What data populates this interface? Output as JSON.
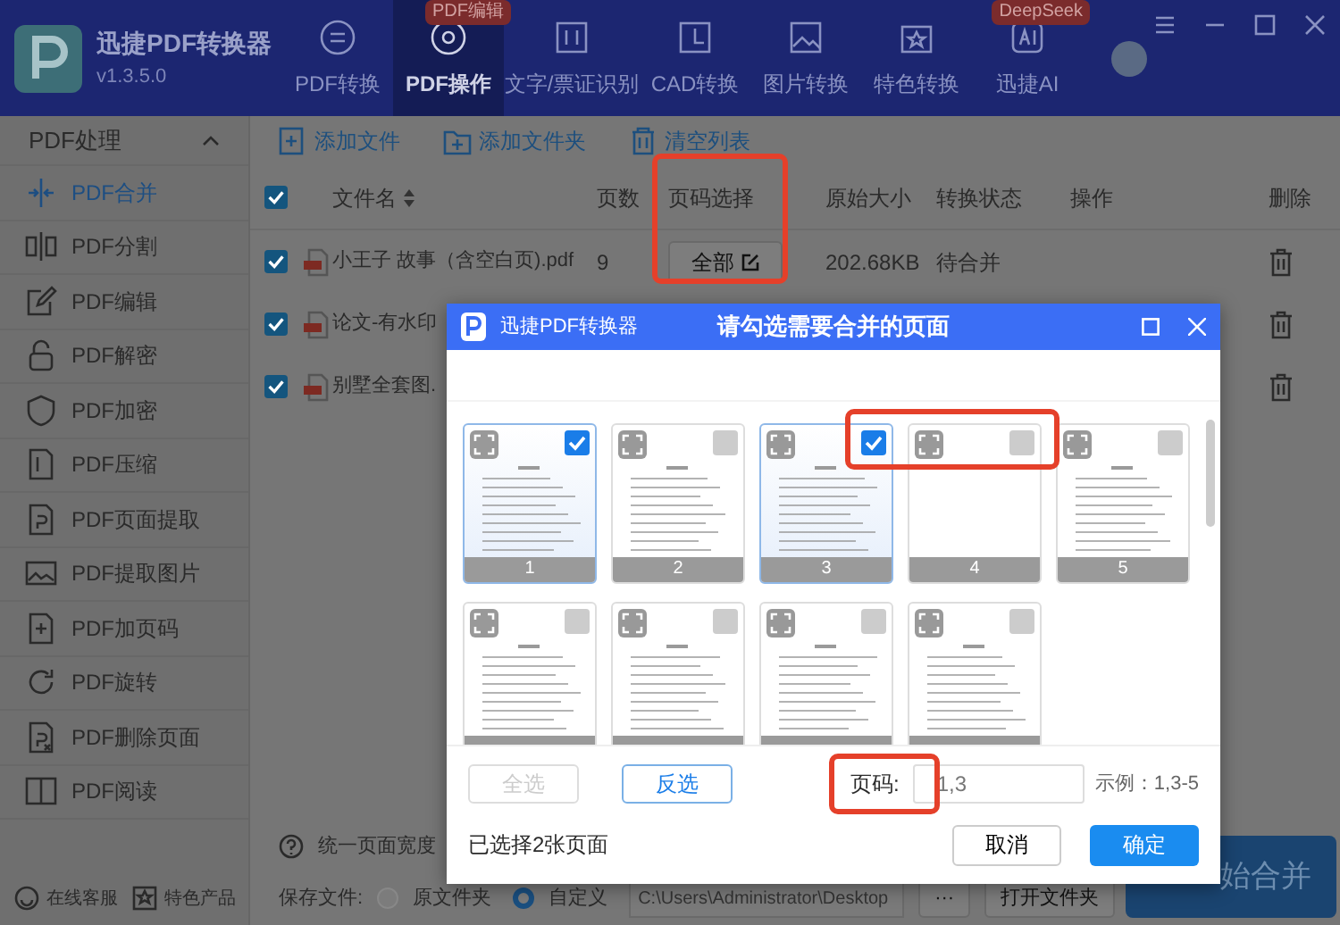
{
  "app": {
    "name": "迅捷PDF转换器",
    "version": "v1.3.5.0"
  },
  "nav_tabs": [
    {
      "label": "PDF转换",
      "selected": false
    },
    {
      "label": "PDF操作",
      "selected": true,
      "badge": "PDF编辑"
    },
    {
      "label": "文字/票证识别",
      "selected": false
    },
    {
      "label": "CAD转换",
      "selected": false
    },
    {
      "label": "图片转换",
      "selected": false
    },
    {
      "label": "特色转换",
      "selected": false
    },
    {
      "label": "迅捷AI",
      "selected": false,
      "badge": "DeepSeek"
    }
  ],
  "sidebar": {
    "title": "PDF处理",
    "expanded": true,
    "items": [
      {
        "label": "PDF合并",
        "selected": true
      },
      {
        "label": "PDF分割",
        "selected": false
      },
      {
        "label": "PDF编辑",
        "selected": false
      },
      {
        "label": "PDF解密",
        "selected": false
      },
      {
        "label": "PDF加密",
        "selected": false
      },
      {
        "label": "PDF压缩",
        "selected": false
      },
      {
        "label": "PDF页面提取",
        "selected": false
      },
      {
        "label": "PDF提取图片",
        "selected": false
      },
      {
        "label": "PDF加页码",
        "selected": false
      },
      {
        "label": "PDF旋转",
        "selected": false
      },
      {
        "label": "PDF删除页面",
        "selected": false
      },
      {
        "label": "PDF阅读",
        "selected": false
      }
    ],
    "footer_links": [
      "在线客服",
      "特色产品"
    ]
  },
  "toolbar": [
    "添加文件",
    "添加文件夹",
    "清空列表"
  ],
  "table": {
    "all_checked": true,
    "columns": [
      "文件名",
      "页数",
      "页码选择",
      "原始大小",
      "转换状态",
      "操作",
      "删除"
    ],
    "rows": [
      {
        "checked": true,
        "file": "小王子 故事（含空白页).pdf",
        "pages": "9",
        "range": "全部",
        "size": "202.68KB",
        "status": "待合并"
      },
      {
        "checked": true,
        "file": "论文-有水印"
      },
      {
        "checked": true,
        "file": "别墅全套图."
      }
    ]
  },
  "options": {
    "uniform_width_label": "统一页面宽度",
    "save_label": "保存文件:",
    "save_options": [
      {
        "label": "原文件夹",
        "selected": false
      },
      {
        "label": "自定义",
        "selected": true
      }
    ],
    "path": "C:\\Users\\Administrator\\Desktop",
    "browse": "···",
    "open_folder": "打开文件夹",
    "start": "始合并"
  },
  "dialog": {
    "app_name": "迅捷PDF转换器",
    "title": "请勾选需要合并的页面",
    "pages": [
      {
        "number": "1",
        "checked": true,
        "kind": "text"
      },
      {
        "number": "2",
        "checked": false,
        "kind": "text"
      },
      {
        "number": "3",
        "checked": true,
        "kind": "text"
      },
      {
        "number": "4",
        "checked": false,
        "kind": "blank"
      },
      {
        "number": "5",
        "checked": false,
        "kind": "text"
      },
      {
        "checked": false,
        "kind": "text"
      },
      {
        "checked": false,
        "kind": "text"
      },
      {
        "checked": false,
        "kind": "text"
      },
      {
        "checked": false,
        "kind": "text"
      }
    ],
    "select_all": {
      "label": "全选",
      "disabled": true
    },
    "invert": {
      "label": "反选",
      "disabled": false
    },
    "page_label": "页码:",
    "page_value": "1,3",
    "example": "示例：1,3-5",
    "selected_count": "已选择2张页面",
    "buttons": [
      "取消",
      "确定"
    ]
  }
}
